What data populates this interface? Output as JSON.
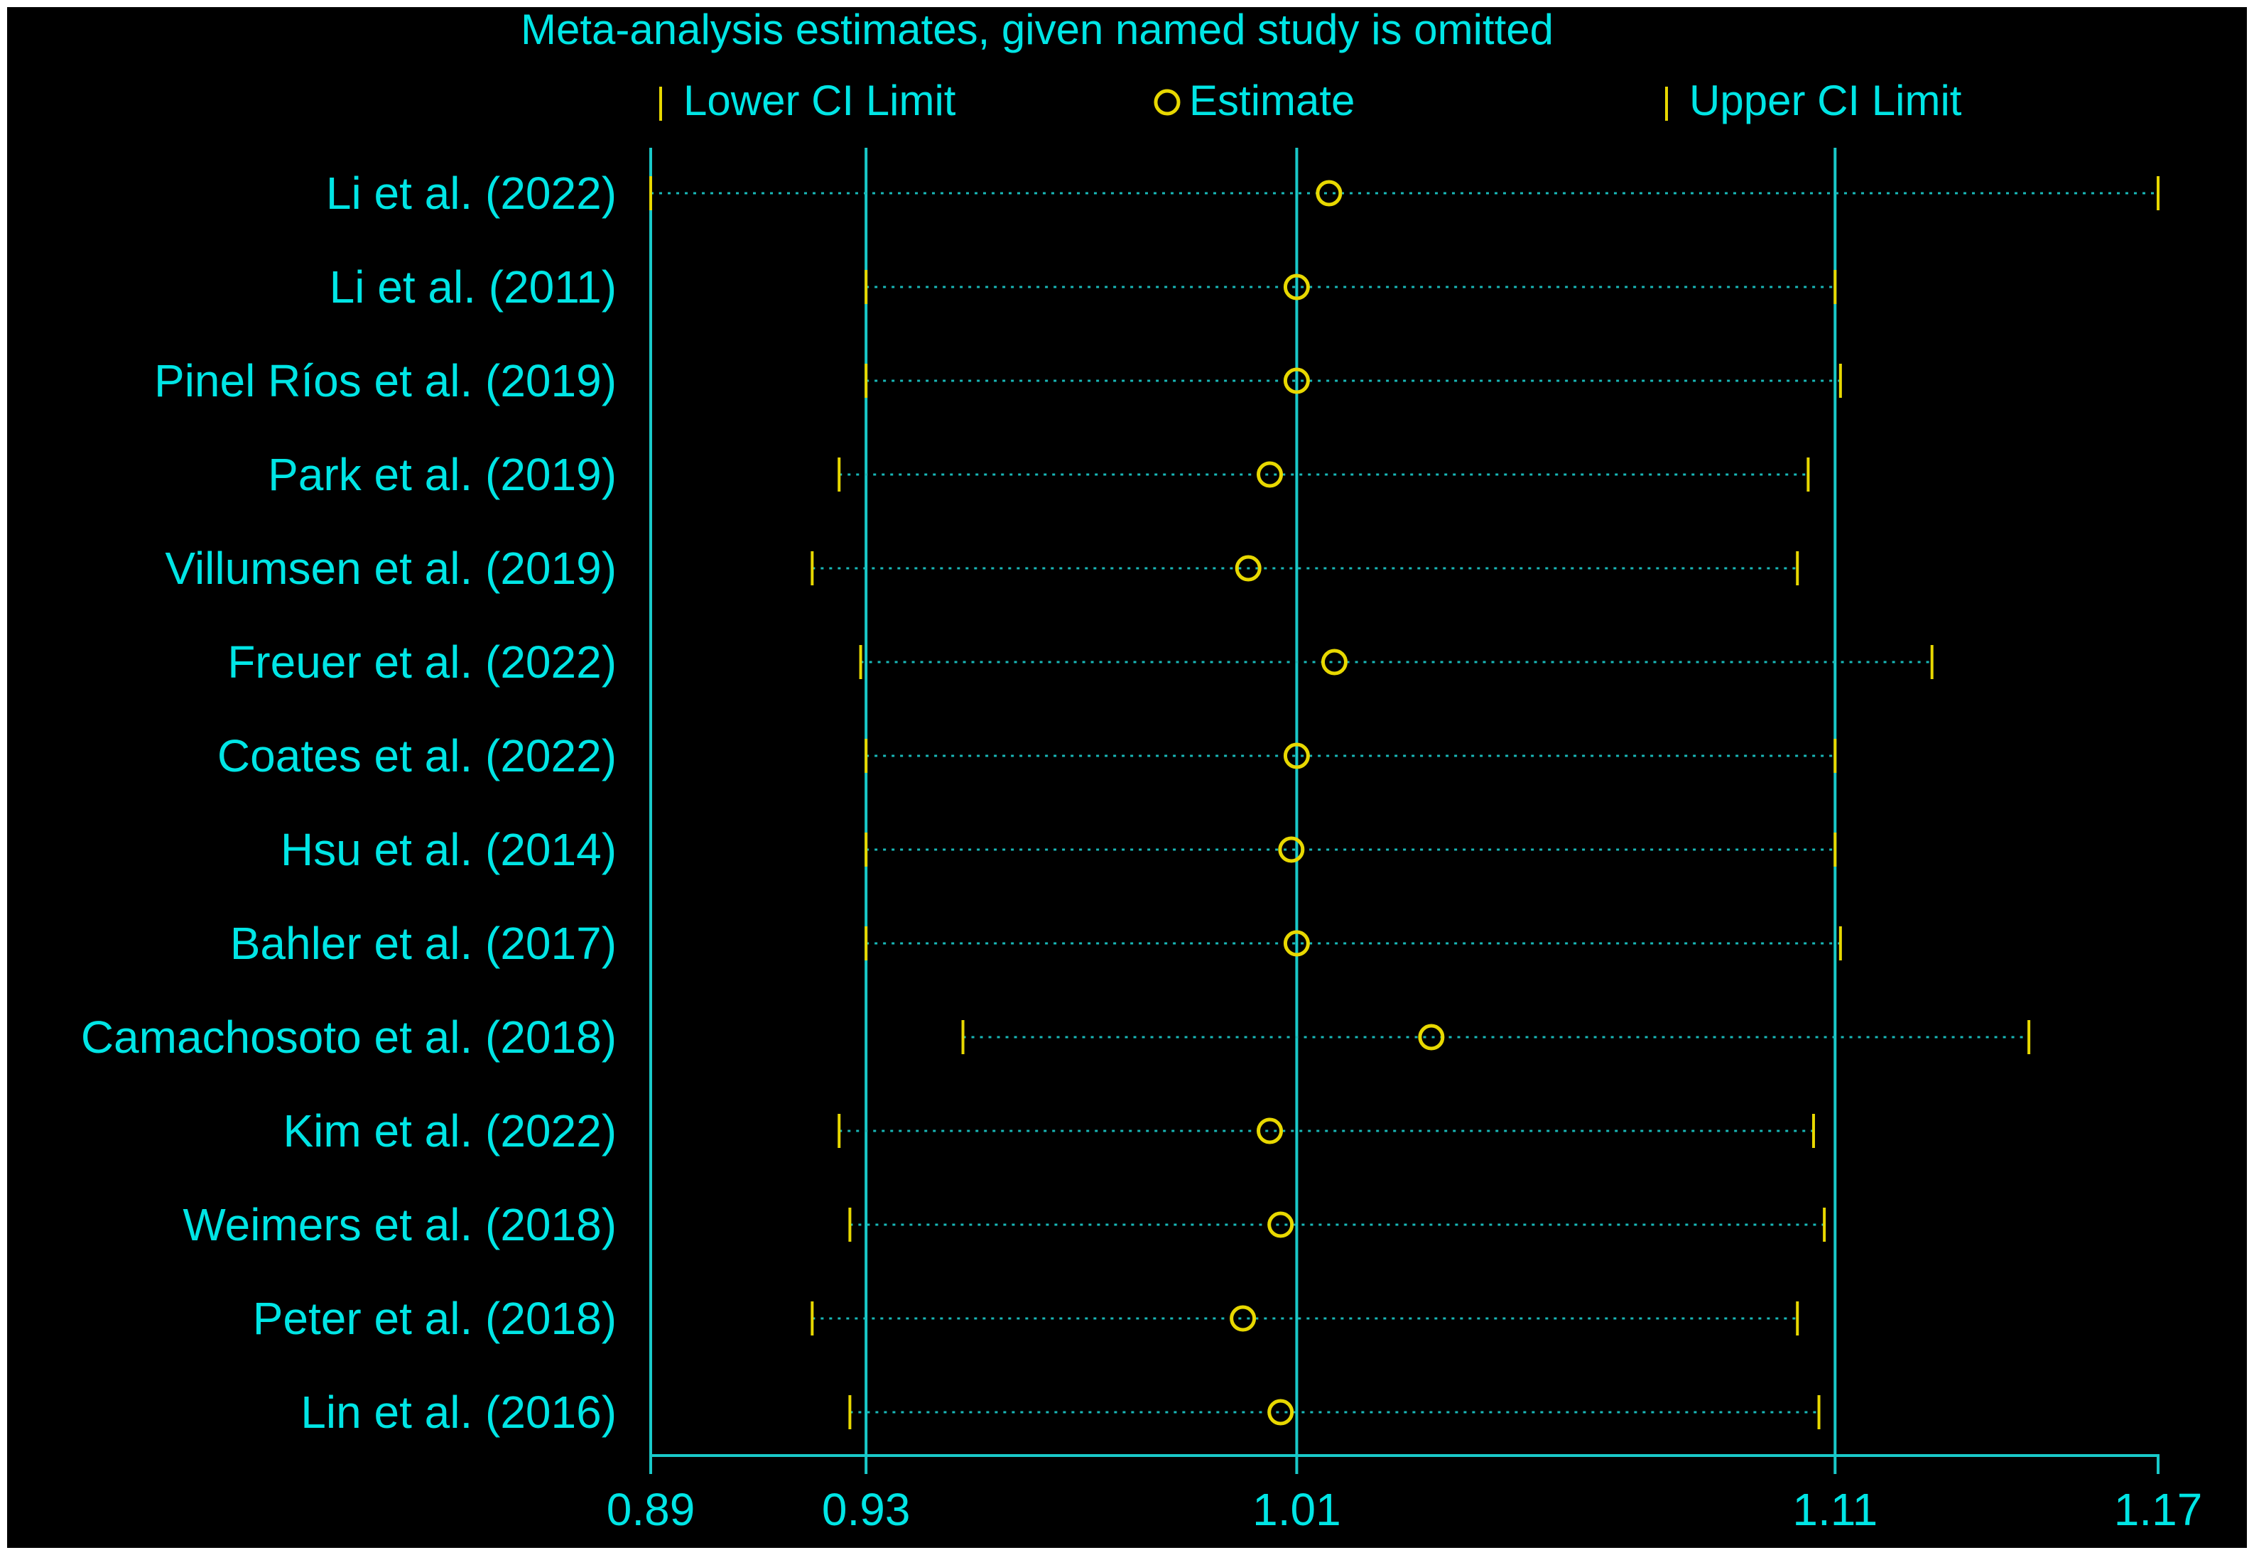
{
  "chart_data": {
    "type": "forest",
    "title": "Meta-analysis estimates, given named study is omitted",
    "legend": {
      "lower_label": "Lower CI Limit",
      "estimate_label": "Estimate",
      "upper_label": "Upper CI Limit",
      "placement": "top"
    },
    "xlim": [
      0.89,
      1.17
    ],
    "xticks": [
      {
        "value": 0.89,
        "label": "0.89"
      },
      {
        "value": 0.93,
        "label": "0.93"
      },
      {
        "value": 1.01,
        "label": "1.01"
      },
      {
        "value": 1.11,
        "label": "1.11"
      },
      {
        "value": 1.17,
        "label": "1.17"
      }
    ],
    "reference_lines": [
      0.89,
      0.93,
      1.01,
      1.11
    ],
    "studies": [
      {
        "name": "Li et al.  (2022)",
        "lower": 0.89,
        "estimate": 1.016,
        "upper": 1.17
      },
      {
        "name": "Li et al.  (2011)",
        "lower": 0.93,
        "estimate": 1.01,
        "upper": 1.11
      },
      {
        "name": "Pinel Ríos et al. (2019)",
        "lower": 0.93,
        "estimate": 1.01,
        "upper": 1.111
      },
      {
        "name": "Park et al. (2019)",
        "lower": 0.925,
        "estimate": 1.005,
        "upper": 1.105
      },
      {
        "name": "Villumsen et al. (2019)",
        "lower": 0.92,
        "estimate": 1.001,
        "upper": 1.103
      },
      {
        "name": "Freuer et al.  (2022)",
        "lower": 0.929,
        "estimate": 1.017,
        "upper": 1.128
      },
      {
        "name": "Coates et al. (2022)",
        "lower": 0.93,
        "estimate": 1.01,
        "upper": 1.11
      },
      {
        "name": "Hsu et al.  (2014)",
        "lower": 0.93,
        "estimate": 1.009,
        "upper": 1.11
      },
      {
        "name": "Bahler et al. (2017)",
        "lower": 0.93,
        "estimate": 1.01,
        "upper": 1.111
      },
      {
        "name": "Camachosoto et al. (2018)",
        "lower": 0.948,
        "estimate": 1.035,
        "upper": 1.146
      },
      {
        "name": "Kim et al.  (2022)",
        "lower": 0.925,
        "estimate": 1.005,
        "upper": 1.106
      },
      {
        "name": "Weimers et al. (2018)",
        "lower": 0.927,
        "estimate": 1.007,
        "upper": 1.108
      },
      {
        "name": "Peter et al.  (2018)",
        "lower": 0.92,
        "estimate": 1.0,
        "upper": 1.103
      },
      {
        "name": "Lin et al. (2016)",
        "lower": 0.927,
        "estimate": 1.007,
        "upper": 1.107
      }
    ],
    "colors": {
      "background": "#000000",
      "text": "#00e5e5",
      "reference_line": "#19c9c9",
      "dotted_line": "#19b8b8",
      "marker": "#e8d800"
    },
    "grid": false
  }
}
